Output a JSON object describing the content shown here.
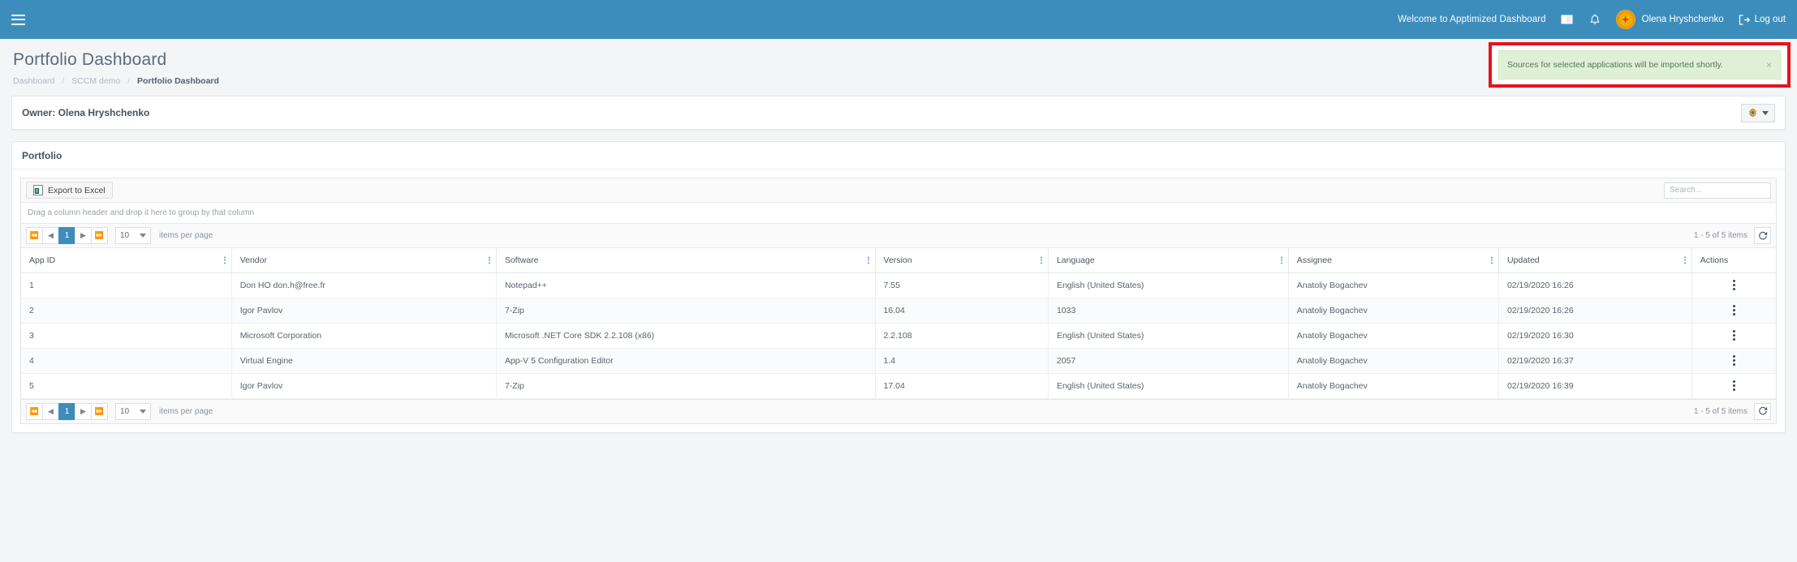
{
  "navbar": {
    "menu_icon": "hamburger-icon",
    "welcome_text": "Welcome to Apptimized Dashboard",
    "book_icon": "book-icon",
    "bell_icon": "bell-icon",
    "user_name": "Olena Hryshchenko",
    "logout_label": "Log out",
    "background": "#3d8dbc"
  },
  "header": {
    "title": "Portfolio Dashboard",
    "breadcrumb": [
      {
        "label": "Dashboard",
        "active": false
      },
      {
        "label": "SCCM demo",
        "active": false
      },
      {
        "label": "Portfolio Dashboard",
        "active": true
      }
    ],
    "separator": "/"
  },
  "alert": {
    "message": "Sources for selected applications will be imported shortly.",
    "close_label": "×",
    "background": "#dff0d8",
    "text_color": "#557553",
    "highlight_color": "#e8121a"
  },
  "owner_card": {
    "label": "Owner: Olena Hryshchenko",
    "settings_icon": "gear-icon"
  },
  "panel": {
    "title": "Portfolio"
  },
  "toolbar": {
    "export_label": "Export to Excel",
    "export_icon": "excel-icon",
    "search_placeholder": "Search...",
    "search_value": ""
  },
  "group_hint": "Drag a column header and drop it here to group by that column",
  "pager": {
    "first_icon": "first-page-icon",
    "prev_icon": "prev-page-icon",
    "next_icon": "next-page-icon",
    "last_icon": "last-page-icon",
    "current_page": "1",
    "page_size": "10",
    "items_per_page_label": "items per page",
    "range_label": "1 - 5 of 5 items",
    "refresh_icon": "refresh-icon"
  },
  "grid": {
    "columns": [
      {
        "label": "App ID",
        "width": "8.5%"
      },
      {
        "label": "Vendor",
        "width": "10.7%"
      },
      {
        "label": "Software",
        "width": "15.3%"
      },
      {
        "label": "Version",
        "width": "7%"
      },
      {
        "label": "Language",
        "width": "9.7%"
      },
      {
        "label": "Assignee",
        "width": "8.5%"
      },
      {
        "label": "Updated",
        "width": "7.8%"
      },
      {
        "label": "Actions",
        "width": "3.4%"
      }
    ],
    "rows": [
      {
        "app_id": "1",
        "vendor": "Don HO don.h@free.fr",
        "software": "Notepad++",
        "version": "7.55",
        "language": "English (United States)",
        "assignee": "Anatoliy Bogachev",
        "updated": "02/19/2020 16:26"
      },
      {
        "app_id": "2",
        "vendor": "Igor Pavlov",
        "software": "7-Zip",
        "version": "16.04",
        "language": "1033",
        "assignee": "Anatoliy Bogachev",
        "updated": "02/19/2020 16:26"
      },
      {
        "app_id": "3",
        "vendor": "Microsoft Corporation",
        "software": "Microsoft .NET Core SDK 2.2.108 (x86)",
        "version": "2.2.108",
        "language": "English (United States)",
        "assignee": "Anatoliy Bogachev",
        "updated": "02/19/2020 16:30"
      },
      {
        "app_id": "4",
        "vendor": "Virtual Engine",
        "software": "App-V 5 Configuration Editor",
        "version": "1.4",
        "language": "2057",
        "assignee": "Anatoliy Bogachev",
        "updated": "02/19/2020 16:37"
      },
      {
        "app_id": "5",
        "vendor": "Igor Pavlov",
        "software": "7-Zip",
        "version": "17.04",
        "language": "English (United States)",
        "assignee": "Anatoliy Bogachev",
        "updated": "02/19/2020 16:39"
      }
    ],
    "row_action_icon": "kebab-menu-icon"
  }
}
